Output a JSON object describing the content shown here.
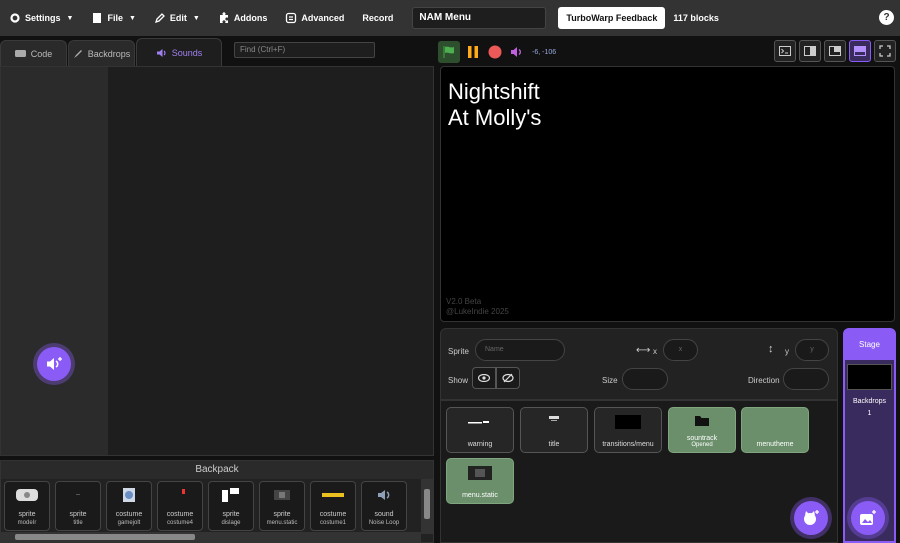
{
  "menubar": {
    "settings": "Settings",
    "file": "File",
    "edit": "Edit",
    "addons": "Addons",
    "advanced": "Advanced",
    "record": "Record",
    "project_title": "NAM Menu",
    "feedback": "TurboWarp Feedback",
    "blocks_count": "117 blocks",
    "help": "?"
  },
  "tabs": {
    "code": "Code",
    "backdrops": "Backdrops",
    "sounds": "Sounds"
  },
  "find": {
    "placeholder": "Find (Ctrl+F)"
  },
  "stage_controls": {
    "coords": "-6, -106"
  },
  "stage": {
    "line1": "Nightshift",
    "line2": "At Molly's",
    "footer1": "V2.0 Beta",
    "footer2": "@LukeIndie 2025"
  },
  "sprite_info": {
    "sprite_label": "Sprite",
    "sprite_placeholder": "Name",
    "x_label": "x",
    "x_placeholder": "x",
    "y_label": "y",
    "y_placeholder": "y",
    "show_label": "Show",
    "size_label": "Size",
    "direction_label": "Direction"
  },
  "sprites": [
    {
      "name": "warning",
      "sub": ""
    },
    {
      "name": "title",
      "sub": ""
    },
    {
      "name": "transitions/menu",
      "sub": ""
    },
    {
      "name": "sountrack",
      "sub": "Opened"
    },
    {
      "name": "menutheme",
      "sub": ""
    },
    {
      "name": "menu.static",
      "sub": ""
    }
  ],
  "stage_panel": {
    "tab": "Stage",
    "backdrops_label": "Backdrops",
    "backdrops_count": "1"
  },
  "backpack": {
    "title": "Backpack",
    "items": [
      {
        "type": "sprite",
        "name": "modeIr"
      },
      {
        "type": "sprite",
        "name": "title"
      },
      {
        "type": "costume",
        "name": "gamejolt"
      },
      {
        "type": "costume",
        "name": "costume4"
      },
      {
        "type": "sprite",
        "name": "dislage"
      },
      {
        "type": "sprite",
        "name": "menu.static"
      },
      {
        "type": "costume",
        "name": "costume1"
      },
      {
        "type": "sound",
        "name": "Noise Loop"
      }
    ]
  },
  "colors": {
    "accent": "#8a5cf5",
    "green_tile": "#6b8f6b",
    "flag": "#4caf50",
    "pause": "#ffab19",
    "stop": "#ec5959"
  }
}
